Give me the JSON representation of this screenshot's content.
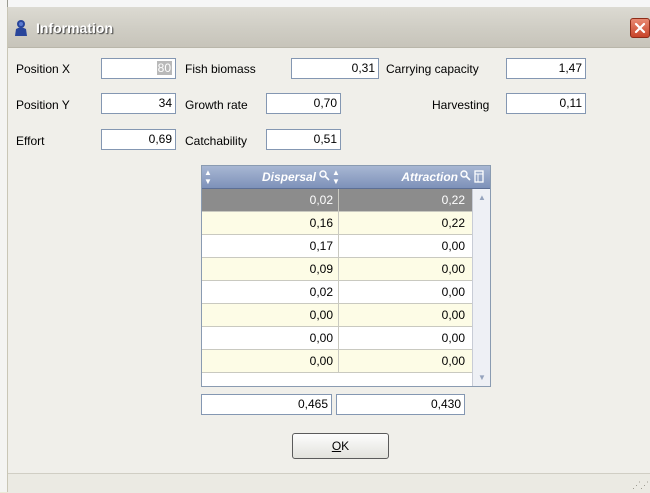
{
  "window": {
    "title": "Information"
  },
  "fields": {
    "position_x": {
      "label": "Position X",
      "value": "80"
    },
    "position_y": {
      "label": "Position Y",
      "value": "34"
    },
    "effort": {
      "label": "Effort",
      "value": "0,69"
    },
    "fish_biomass": {
      "label": "Fish biomass",
      "value": "0,31"
    },
    "growth_rate": {
      "label": "Growth rate",
      "value": "0,70"
    },
    "catchability": {
      "label": "Catchability",
      "value": "0,51"
    },
    "carrying_capacity": {
      "label": "Carrying capacity",
      "value": "1,47"
    },
    "harvesting": {
      "label": "Harvesting",
      "value": "0,11"
    }
  },
  "table": {
    "columns": [
      "Dispersal",
      "Attraction"
    ],
    "rows": [
      [
        "0,02",
        "0,22"
      ],
      [
        "0,16",
        "0,22"
      ],
      [
        "0,17",
        "0,00"
      ],
      [
        "0,09",
        "0,00"
      ],
      [
        "0,02",
        "0,00"
      ],
      [
        "0,00",
        "0,00"
      ],
      [
        "0,00",
        "0,00"
      ],
      [
        "0,00",
        "0,00"
      ]
    ],
    "totals": [
      "0,465",
      "0,430"
    ],
    "selected_row": 0
  },
  "buttons": {
    "ok": {
      "label": "OK",
      "mnemonic": "O",
      "rest": "K"
    }
  },
  "colors": {
    "row_even": "#ffffff",
    "row_odd": "#fdfce6",
    "row_selected": "#8c8c8c",
    "header": "#8fa1c7"
  },
  "icons": [
    "app-icon",
    "close-icon",
    "search-icon",
    "sort-icon",
    "column-chooser-icon",
    "scroll-up-icon",
    "scroll-down-icon",
    "resize-grip-icon"
  ]
}
